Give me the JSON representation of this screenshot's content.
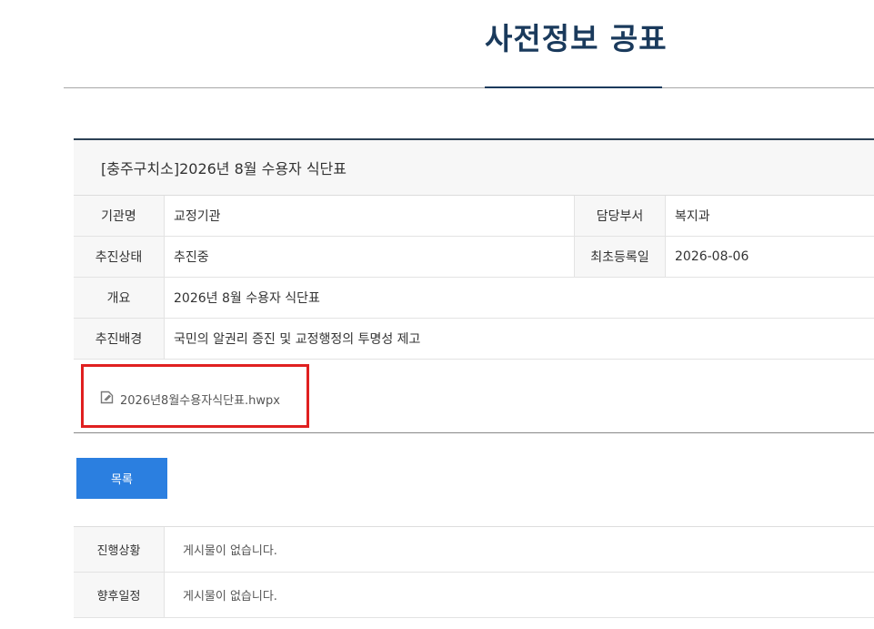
{
  "page": {
    "title": "사전정보 공표"
  },
  "detail": {
    "post_title": "[충주구치소]2026년 8월 수용자 식단표",
    "agency_label": "기관명",
    "agency_value": "교정기관",
    "dept_label": "담당부서",
    "dept_value": "복지과",
    "status_label": "추진상태",
    "status_value": "추진중",
    "registered_label": "최초등록일",
    "registered_value": "2026-08-06",
    "summary_label": "개요",
    "summary_value": "2026년 8월 수용자 식단표",
    "background_label": "추진배경",
    "background_value": "국민의 알권리 증진 및 교정행정의 투명성 제고",
    "attachment": {
      "filename": "2026년8월수용자식단표.hwpx",
      "icon": "attachment-icon"
    },
    "highlight_color": "#e02020"
  },
  "actions": {
    "list_label": "목록"
  },
  "progress": {
    "rows": [
      {
        "label": "진행상황",
        "value": "게시물이 없습니다."
      },
      {
        "label": "향후일정",
        "value": "게시물이 없습니다."
      }
    ]
  },
  "colors": {
    "title": "#1a3a5c",
    "button": "#2b7fe0"
  }
}
